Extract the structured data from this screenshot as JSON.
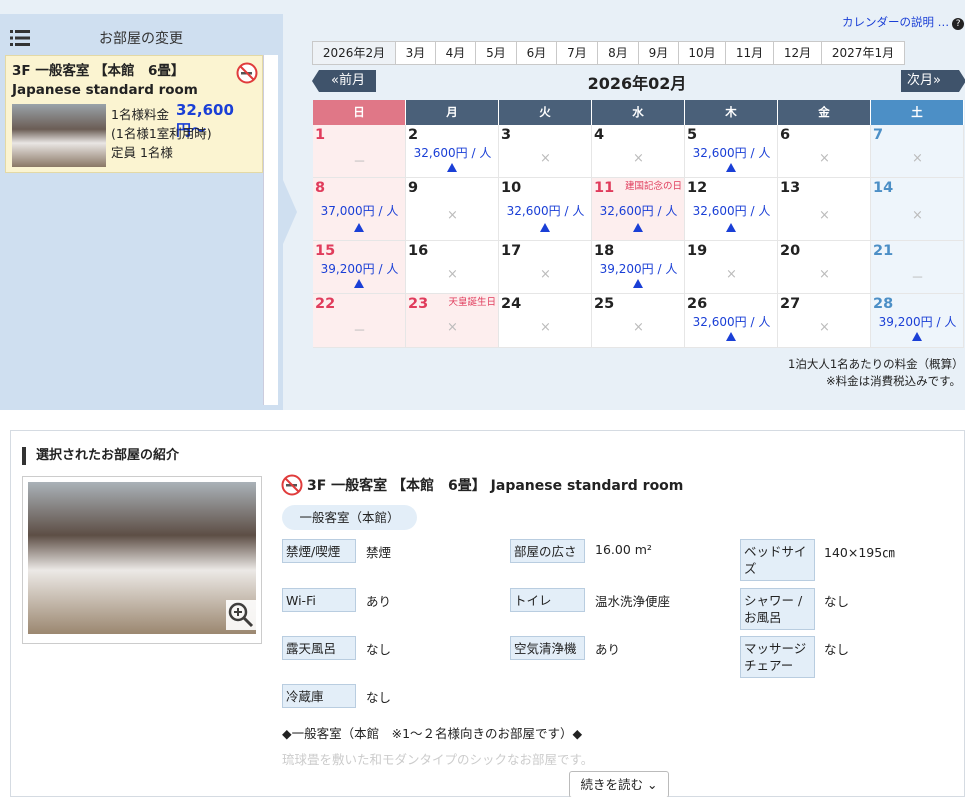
{
  "sidebar": {
    "title": "お部屋の変更",
    "room": {
      "title": "3F 一般客室 【本館　6畳】Japanese standard room",
      "price_label": "1名様料金",
      "price": "32,600円〜",
      "note": "(1名様1室利用時)",
      "capacity": "定員 1名様"
    }
  },
  "calendar": {
    "help_link": "カレンダーの説明 …",
    "help_icon": "?",
    "tabs": [
      "2026年2月",
      "3月",
      "4月",
      "5月",
      "6月",
      "7月",
      "8月",
      "9月",
      "10月",
      "11月",
      "12月",
      "2027年1月"
    ],
    "prev_label": "前月",
    "next_label": "次月",
    "month_title": "2026年02月",
    "weekdays": [
      "日",
      "月",
      "火",
      "水",
      "木",
      "金",
      "土"
    ],
    "weeks": [
      [
        {
          "day": "1",
          "kind": "sun",
          "mark": "－"
        },
        {
          "day": "2",
          "price": "32,600円 / 人",
          "tri": true
        },
        {
          "day": "3",
          "mark": "×"
        },
        {
          "day": "4",
          "mark": "×"
        },
        {
          "day": "5",
          "price": "32,600円 / 人",
          "tri": true
        },
        {
          "day": "6",
          "mark": "×"
        },
        {
          "day": "7",
          "kind": "sat",
          "mark": "×"
        }
      ],
      [
        {
          "day": "8",
          "kind": "sun",
          "price": "37,000円 / 人",
          "tri": true
        },
        {
          "day": "9",
          "mark": "×"
        },
        {
          "day": "10",
          "price": "32,600円 / 人",
          "tri": true
        },
        {
          "day": "11",
          "kind": "hol",
          "holiday": "建国記念の日",
          "price": "32,600円 / 人",
          "tri": true
        },
        {
          "day": "12",
          "price": "32,600円 / 人",
          "tri": true
        },
        {
          "day": "13",
          "mark": "×"
        },
        {
          "day": "14",
          "kind": "sat",
          "mark": "×"
        }
      ],
      [
        {
          "day": "15",
          "kind": "sun",
          "price": "39,200円 / 人",
          "tri": true
        },
        {
          "day": "16",
          "mark": "×"
        },
        {
          "day": "17",
          "mark": "×"
        },
        {
          "day": "18",
          "price": "39,200円 / 人",
          "tri": true
        },
        {
          "day": "19",
          "mark": "×"
        },
        {
          "day": "20",
          "mark": "×"
        },
        {
          "day": "21",
          "kind": "sat",
          "mark": "－"
        }
      ],
      [
        {
          "day": "22",
          "kind": "sun",
          "mark": "－"
        },
        {
          "day": "23",
          "kind": "hol",
          "holiday": "天皇誕生日",
          "mark": "×"
        },
        {
          "day": "24",
          "mark": "×"
        },
        {
          "day": "25",
          "mark": "×"
        },
        {
          "day": "26",
          "price": "32,600円 / 人",
          "tri": true
        },
        {
          "day": "27",
          "mark": "×"
        },
        {
          "day": "28",
          "kind": "sat",
          "price": "39,200円 / 人",
          "tri": true
        }
      ]
    ],
    "note1": "1泊大人1名あたりの料金（概算）",
    "note2": "※料金は消費税込みです。"
  },
  "detail": {
    "heading": "選択されたお部屋の紹介",
    "room_name": "3F 一般客室 【本館　6畳】 Japanese standard room",
    "tag": "一般客室（本館）",
    "specs": [
      {
        "label": "禁煙/喫煙",
        "value": "禁煙"
      },
      {
        "label": "部屋の広さ",
        "value": "16.00 m²"
      },
      {
        "label": "ベッドサイズ",
        "value": "140×195㎝"
      },
      {
        "label": "Wi-Fi",
        "value": "あり"
      },
      {
        "label": "トイレ",
        "value": "温水洗浄便座"
      },
      {
        "label": "シャワー / お風呂",
        "value": "なし"
      },
      {
        "label": "露天風呂",
        "value": "なし"
      },
      {
        "label": "空気清浄機",
        "value": "あり"
      },
      {
        "label": "マッサージチェアー",
        "value": "なし"
      },
      {
        "label": "冷蔵庫",
        "value": "なし"
      }
    ],
    "description": "◆一般客室（本館　※1〜２名様向きのお部屋です）◆",
    "description_faded": "琉球畳を敷いた和モダンタイプのシックなお部屋です。",
    "more_label": "続きを読む"
  }
}
